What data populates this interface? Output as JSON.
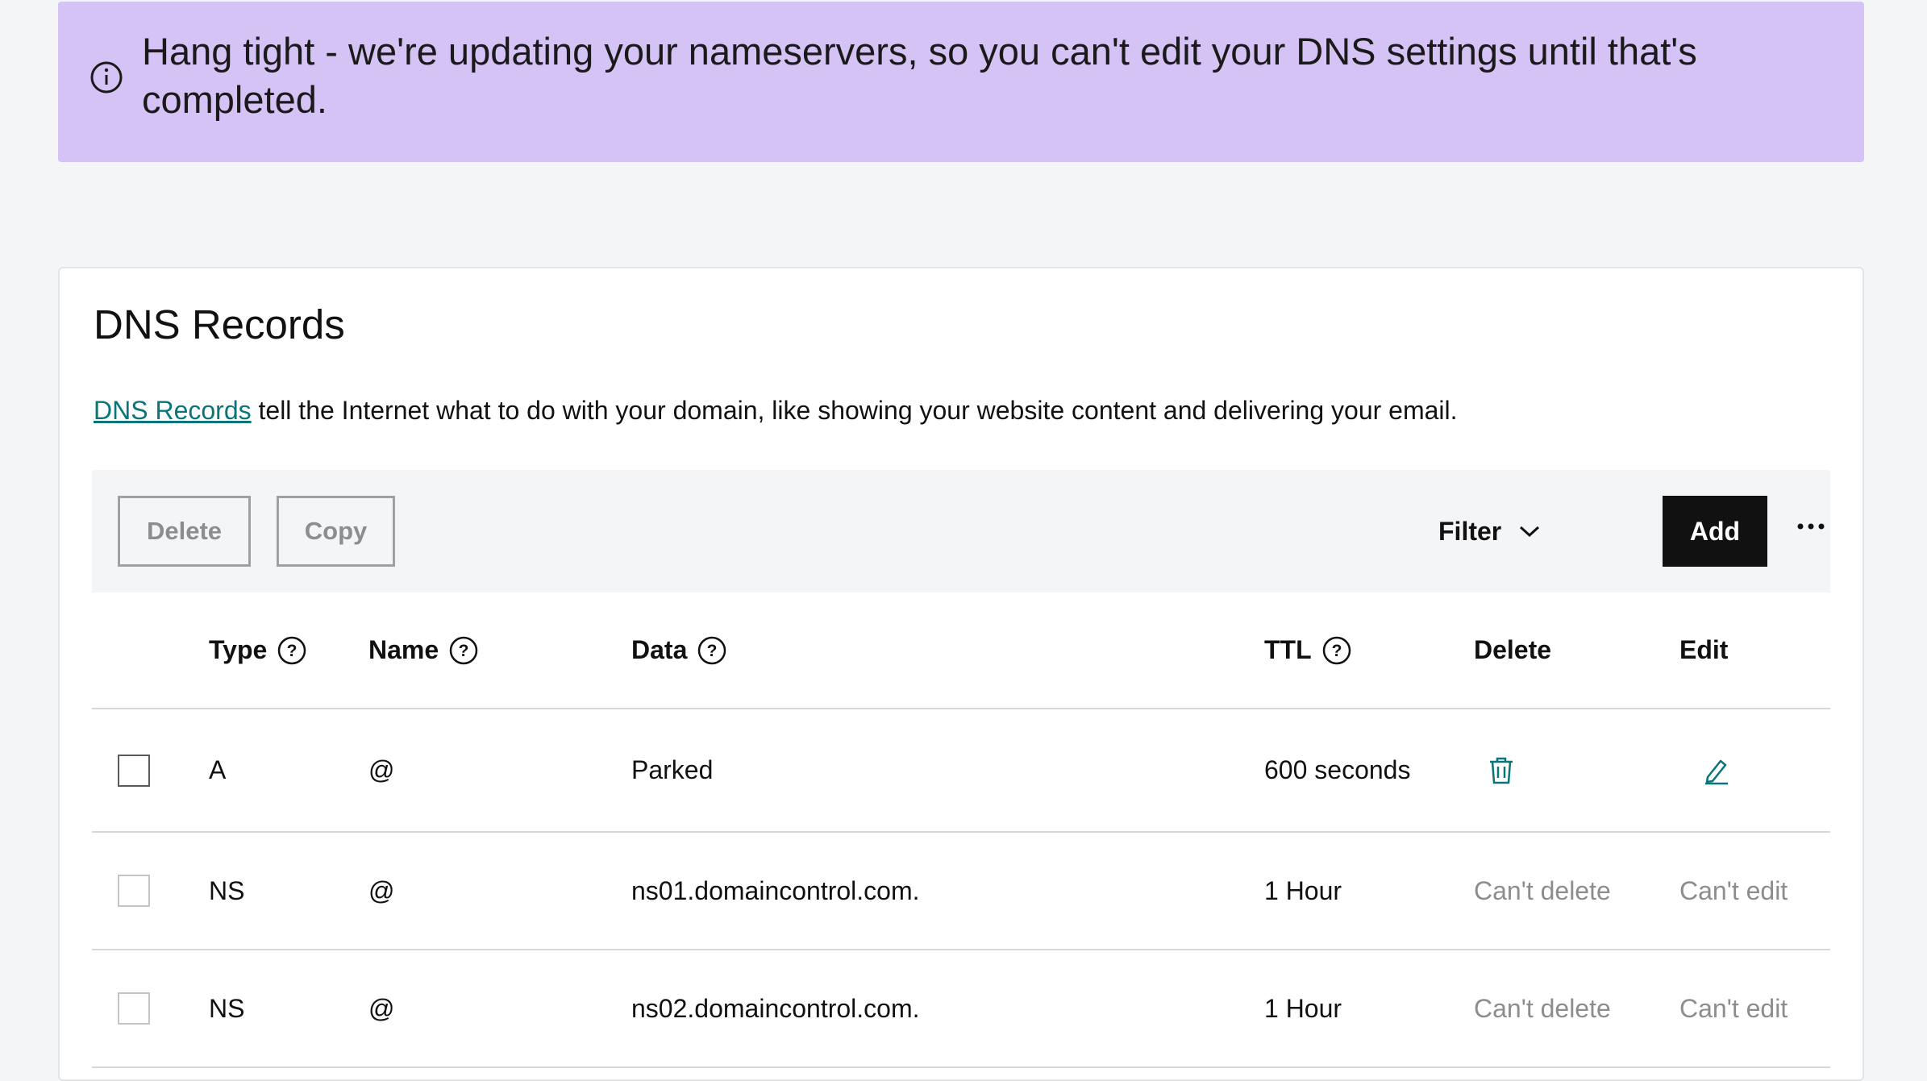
{
  "banner": {
    "icon": "info-icon",
    "line1": "Hang tight - we're updating your nameservers, so you can't edit your DNS settings until that's",
    "line2": "completed."
  },
  "card": {
    "title": "DNS Records",
    "description_link": "DNS Records",
    "description_text": " tell the Internet what to do with your domain, like showing your website content and delivering your email."
  },
  "toolbar": {
    "delete_label": "Delete",
    "copy_label": "Copy",
    "filter_label": "Filter",
    "add_label": "Add",
    "more_icon": "more-horizontal-icon"
  },
  "table": {
    "headers": {
      "type": "Type",
      "name": "Name",
      "data": "Data",
      "ttl": "TTL",
      "delete": "Delete",
      "edit": "Edit"
    },
    "rows": [
      {
        "type": "A",
        "name": "@",
        "data": "Parked",
        "ttl": "600 seconds",
        "delete": "trash-icon",
        "edit": "pencil-icon"
      },
      {
        "type": "NS",
        "name": "@",
        "data": "ns01.domaincontrol.com.",
        "ttl": "1 Hour",
        "delete": "Can't delete",
        "edit": "Can't edit"
      },
      {
        "type": "NS",
        "name": "@",
        "data": "ns02.domaincontrol.com.",
        "ttl": "1 Hour",
        "delete": "Can't delete",
        "edit": "Can't edit"
      }
    ]
  },
  "colors": {
    "banner_bg": "#d4c3f4",
    "link": "#09757a",
    "primary_button": "#111111",
    "muted_text": "#8c8d8f"
  }
}
